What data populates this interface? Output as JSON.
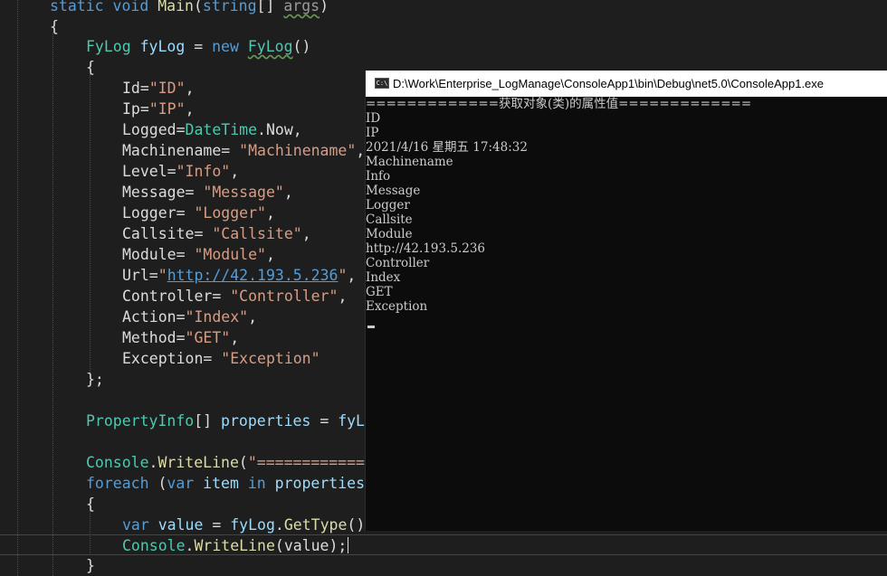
{
  "editor": {
    "lines": {
      "l0": {
        "a": "static",
        "b": "void",
        "c": "Main",
        "d": "(",
        "e": "string",
        "f": "[]",
        "g": "args",
        "h": ")"
      },
      "l1": {
        "a": "{"
      },
      "l2": {
        "a": "FyLog",
        "b": "fyLog",
        "c": "=",
        "d": "new",
        "e": "FyLog",
        "f": "()"
      },
      "l3": {
        "a": "{"
      },
      "l4": {
        "a": "Id=",
        "b": "\"ID\"",
        "c": ","
      },
      "l5": {
        "a": "Ip=",
        "b": "\"IP\"",
        "c": ","
      },
      "l6": {
        "a": "Logged=",
        "b": "DateTime",
        "c": ".Now,"
      },
      "l7": {
        "a": "Machinename=",
        "b": "\"Machinename\"",
        "c": ","
      },
      "l8": {
        "a": "Level=",
        "b": "\"Info\"",
        "c": ","
      },
      "l9": {
        "a": "Message=",
        "b": "\"Message\"",
        "c": ","
      },
      "l10": {
        "a": "Logger=",
        "b": "\"Logger\"",
        "c": ","
      },
      "l11": {
        "a": "Callsite=",
        "b": "\"Callsite\"",
        "c": ","
      },
      "l12": {
        "a": "Module=",
        "b": "\"Module\"",
        "c": ","
      },
      "l13": {
        "a": "Url=",
        "b": "\"",
        "c": "http://42.193.5.236",
        "d": "\"",
        "e": ","
      },
      "l14": {
        "a": "Controller=",
        "b": "\"Controller\"",
        "c": ","
      },
      "l15": {
        "a": "Action=",
        "b": "\"Index\"",
        "c": ","
      },
      "l16": {
        "a": "Method=",
        "b": "\"GET\"",
        "c": ","
      },
      "l17": {
        "a": "Exception=",
        "b": "\"Exception\""
      },
      "l18": {
        "a": "};"
      },
      "l19": {
        "a": "PropertyInfo",
        "b": "[]",
        "c": "properties",
        "d": "=",
        "e": "fyL"
      },
      "l20": {
        "a": "Console",
        "b": ".",
        "c": "WriteLine",
        "d": "(",
        "e": "\"============"
      },
      "l21": {
        "a": "foreach",
        "b": "(",
        "c": "var",
        "d": "item",
        "e": "in",
        "f": "properties"
      },
      "l22": {
        "a": "{"
      },
      "l23": {
        "a": "var",
        "b": "value",
        "c": "=",
        "d": "fyLog",
        "e": ".",
        "f": "GetType",
        "g": "()"
      },
      "l24": {
        "a": "Console",
        "b": ".",
        "c": "WriteLine",
        "d": "(value);"
      },
      "l25": {
        "a": "}"
      }
    }
  },
  "console": {
    "title": "D:\\Work\\Enterprise_LogManage\\ConsoleApp1\\bin\\Debug\\net5.0\\ConsoleApp1.exe",
    "icon_label": "C:\\",
    "output": [
      "=============获取对象(类)的属性值=============",
      "ID",
      "IP",
      "2021/4/16 星期五 17:48:32",
      "Machinename",
      "Info",
      "Message",
      "Logger",
      "Callsite",
      "Module",
      "http://42.193.5.236",
      "Controller",
      "Index",
      "GET",
      "Exception"
    ]
  },
  "colors": {
    "editor_bg": "#1e1e1e",
    "keyword": "#569cd6",
    "type": "#4ec9b0",
    "method": "#dcdcaa",
    "string": "#d69d85",
    "identifier": "#9cdcfe",
    "console_bg": "#0c0c0c",
    "console_text": "#cccccc"
  }
}
